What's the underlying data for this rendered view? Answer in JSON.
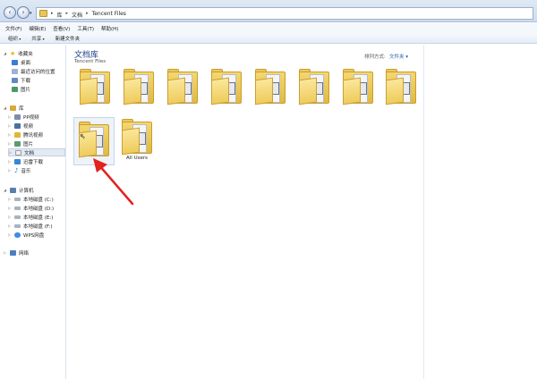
{
  "address": {
    "crumbs": [
      "库",
      "文档",
      "Tencent Files"
    ]
  },
  "menu": [
    "文件(F)",
    "编辑(E)",
    "查看(V)",
    "工具(T)",
    "帮助(H)"
  ],
  "toolbar": {
    "organize": "组织",
    "share": "共享",
    "new_folder": "新建文件夹"
  },
  "sidebar": {
    "favorites": {
      "label": "收藏夹",
      "items": [
        "桌面",
        "最近访问的位置",
        "下载",
        "图片"
      ]
    },
    "libraries": {
      "label": "库",
      "items": [
        "PP视频",
        "视频",
        "腾讯视频",
        "图片",
        "文档",
        "迅雷下载",
        "音乐"
      ]
    },
    "computer": {
      "label": "计算机",
      "items": [
        "本地磁盘 (C:)",
        "本地磁盘 (D:)",
        "本地磁盘 (E:)",
        "本地磁盘 (F:)",
        "WPS网盘"
      ]
    },
    "network": {
      "label": "网络"
    }
  },
  "library": {
    "title": "文档库",
    "subtitle": "Tencent Files",
    "arrange_label": "排列方式:",
    "arrange_value": "文件夹 ▾"
  },
  "folders": {
    "last_label": "All Users"
  },
  "colors": {
    "accent": "#1f3c88",
    "annotation": "#e0231f"
  }
}
